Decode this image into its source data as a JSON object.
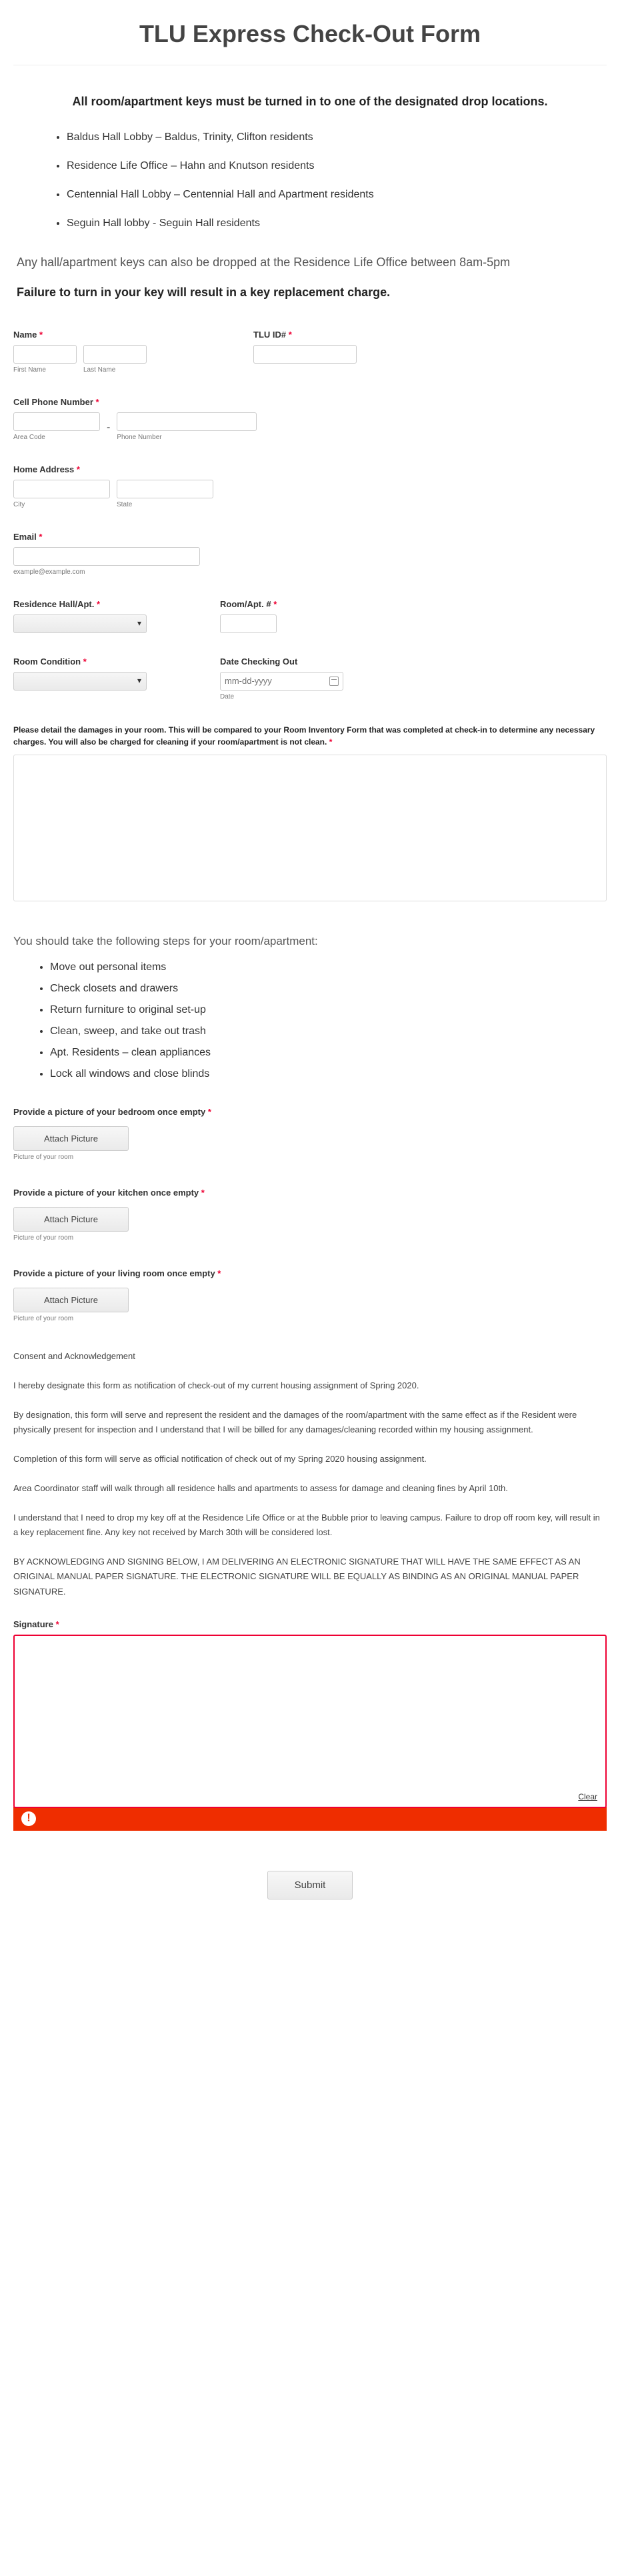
{
  "title": "TLU Express Check-Out Form",
  "intro": "All room/apartment keys must be turned in to one of the designated drop locations.",
  "drop_locations": [
    "Baldus Hall Lobby – Baldus, Trinity, Clifton residents",
    "Residence Life Office – Hahn and Knutson residents",
    "Centennial Hall Lobby – Centennial Hall and Apartment residents",
    "Seguin Hall lobby - Seguin Hall residents"
  ],
  "office_note": "Any hall/apartment keys can also be dropped at the Residence Life Office between 8am-5pm",
  "failure_note": "Failure to turn in your key will result in a key replacement charge.",
  "labels": {
    "name": "Name",
    "first_name": "First Name",
    "last_name": "Last Name",
    "tlu_id": "TLU ID#",
    "cell": "Cell Phone Number",
    "area_code": "Area Code",
    "phone_number": "Phone Number",
    "home_addr": "Home Address",
    "city": "City",
    "state": "State",
    "email": "Email",
    "email_hint": "example@example.com",
    "res_hall": "Residence Hall/Apt.",
    "room_no": "Room/Apt. #",
    "room_cond": "Room Condition",
    "date_out": "Date Checking Out",
    "date_sub": "Date",
    "date_placeholder": "mm-dd-yyyy",
    "damage": "Please detail the damages in your room. This will be compared to your Room Inventory Form that was completed at check-in to determine any necessary charges. You will also be charged for cleaning if your room/apartment is not clean.",
    "steps_heading": "You should take the following steps for your room/apartment:",
    "upload_bedroom": "Provide a picture of your bedroom once empty",
    "upload_kitchen": "Provide a picture of your kitchen once empty",
    "upload_living": "Provide a picture of your living room once empty",
    "attach_btn": "Attach Picture",
    "upload_hint": "Picture of your room",
    "consent_title": "Consent and Acknowledgement",
    "signature": "Signature",
    "clear": "Clear",
    "submit": "Submit"
  },
  "steps": [
    "Move out personal items",
    "Check closets and drawers",
    "Return furniture to original set-up",
    "Clean, sweep, and take out trash",
    "Apt. Residents – clean appliances",
    "Lock all windows and close blinds"
  ],
  "consent_paras": [
    "I hereby designate this form as notification of check-out of my current housing assignment of Spring 2020.",
    "By designation, this form will serve and represent the resident and the damages of the room/apartment with the same effect as if the Resident were physically present for inspection and I understand that I will be billed for any damages/cleaning recorded within my housing assignment.",
    "Completion of this form will serve as official notification of check out of my Spring 2020 housing assignment.",
    "Area Coordinator staff will walk through all residence halls and apartments to assess for damage and cleaning fines by April 10th.",
    "I understand that I need to drop my key off at the Residence Life Office or at the Bubble prior to leaving campus.  Failure to drop off room key, will result in a key replacement fine. Any key not received by March 30th will be considered lost.",
    "BY ACKNOWLEDGING AND SIGNING BELOW, I AM DELIVERING AN ELECTRONIC SIGNATURE THAT WILL HAVE THE SAME EFFECT AS AN ORIGINAL MANUAL PAPER SIGNATURE. THE ELECTRONIC SIGNATURE WILL BE EQUALLY AS BINDING AS AN ORIGINAL MANUAL PAPER SIGNATURE."
  ]
}
